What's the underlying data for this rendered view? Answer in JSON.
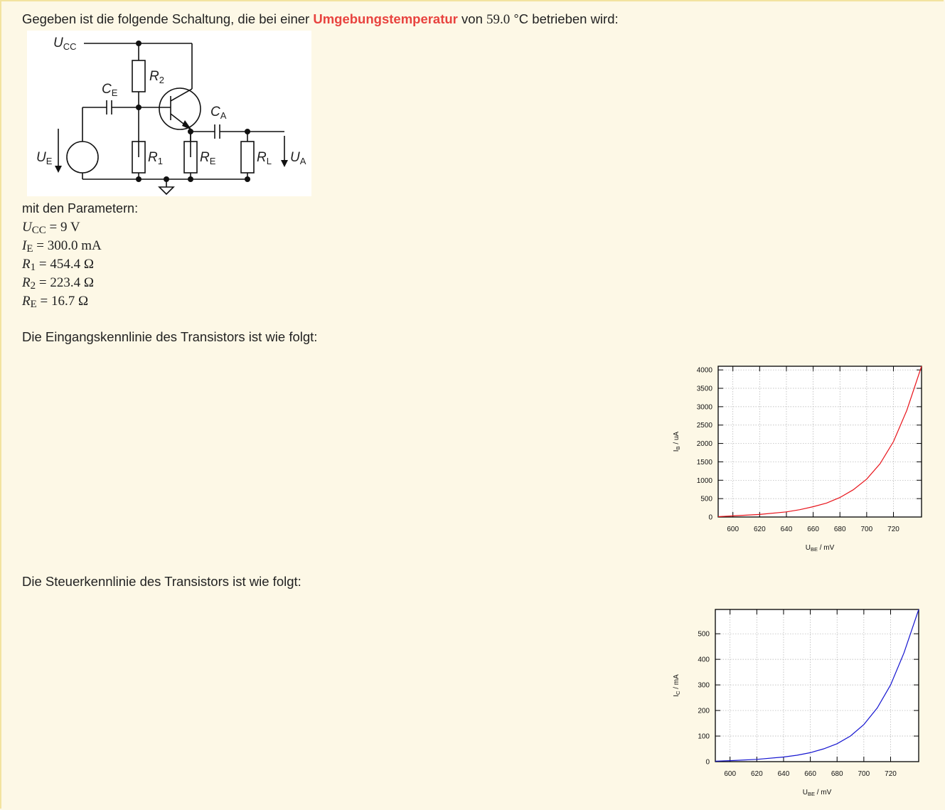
{
  "intro": {
    "prefix": "Gegeben ist die folgende Schaltung, die bei einer",
    "highlight": "Umgebungstemperatur",
    "middle": "von",
    "temperature": "59.0",
    "suffix": "°C betrieben wird:"
  },
  "circuit": {
    "labels": {
      "ucc": "U",
      "ucc_sub": "CC",
      "r2": "R",
      "r2_sub": "2",
      "ce": "C",
      "ce_sub": "E",
      "ca": "C",
      "ca_sub": "A",
      "ue": "U",
      "ue_sub": "E",
      "r1": "R",
      "r1_sub": "1",
      "re": "R",
      "re_sub": "E",
      "rl": "R",
      "rl_sub": "L",
      "ua": "U",
      "ua_sub": "A"
    }
  },
  "params": {
    "title": "mit den Parametern:",
    "rows": [
      {
        "sym": "U",
        "sub": "CC",
        "value": "= 9",
        "unit": "V"
      },
      {
        "sym": "I",
        "sub": "E",
        "value": "= 300.0",
        "unit": "mA"
      },
      {
        "sym": "R",
        "sub": "1",
        "value": "= 454.4",
        "unit": "Ω"
      },
      {
        "sym": "R",
        "sub": "2",
        "value": "= 223.4",
        "unit": "Ω"
      },
      {
        "sym": "R",
        "sub": "E",
        "value": "= 16.7",
        "unit": "Ω"
      }
    ]
  },
  "input_section": {
    "text": "Die Eingangskennlinie des Transistors ist wie folgt:"
  },
  "control_section": {
    "text": "Die Steuerkennlinie des Transistors ist wie folgt:"
  },
  "colors": {
    "accent": "#e8433f",
    "input_curve": "#e8141b",
    "control_curve": "#1515d0",
    "background": "#fdf8e6"
  },
  "chart_data": [
    {
      "type": "line",
      "xlabel": "U",
      "xlabel_sub": "BE",
      "xlabel_unit": " / mV",
      "ylabel": "I",
      "ylabel_sub": "B",
      "ylabel_unit": " / uA",
      "xlim": [
        589,
        741
      ],
      "ylim": [
        0,
        4100
      ],
      "x_ticks": [
        600,
        620,
        640,
        660,
        680,
        700,
        720
      ],
      "y_ticks": [
        0,
        500,
        1000,
        1500,
        2000,
        2500,
        3000,
        3500,
        4000
      ],
      "grid": true,
      "series": [
        {
          "color": "#e8141b",
          "x": [
            589,
            600,
            620,
            640,
            650,
            660,
            670,
            680,
            690,
            700,
            710,
            720,
            730,
            741
          ],
          "values": [
            10,
            30,
            70,
            140,
            200,
            280,
            380,
            530,
            740,
            1030,
            1450,
            2050,
            2900,
            4100
          ]
        }
      ]
    },
    {
      "type": "line",
      "xlabel": "U",
      "xlabel_sub": "BE",
      "xlabel_unit": " / mV",
      "ylabel": "I",
      "ylabel_sub": "C",
      "ylabel_unit": " / mA",
      "xlim": [
        589,
        741
      ],
      "ylim": [
        0,
        595
      ],
      "x_ticks": [
        600,
        620,
        640,
        660,
        680,
        700,
        720
      ],
      "y_ticks": [
        0,
        100,
        200,
        300,
        400,
        500
      ],
      "grid": true,
      "series": [
        {
          "color": "#1515d0",
          "x": [
            589,
            600,
            620,
            640,
            650,
            660,
            670,
            680,
            690,
            700,
            710,
            720,
            730,
            741
          ],
          "values": [
            2,
            4,
            9,
            18,
            25,
            35,
            50,
            70,
            100,
            145,
            210,
            300,
            425,
            595
          ]
        }
      ]
    }
  ]
}
